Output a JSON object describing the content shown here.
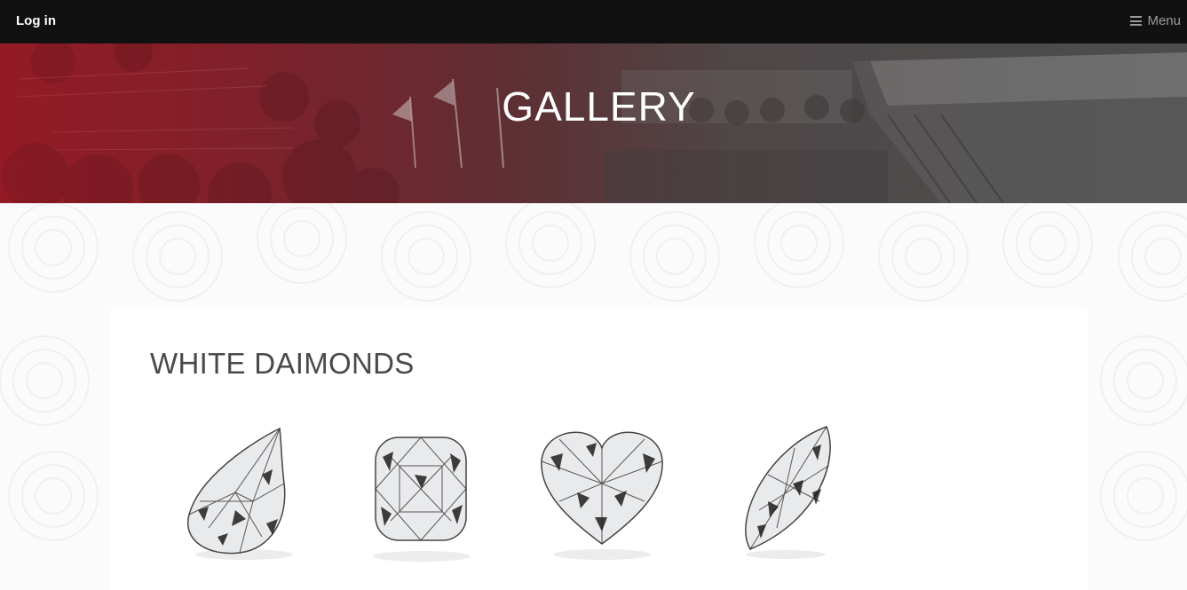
{
  "topbar": {
    "login_label": "Log in",
    "menu_label": "Menu",
    "menu_icon": "hamburger-icon"
  },
  "hero": {
    "title": "GALLERY"
  },
  "gallery": {
    "section_title": "WHITE DAIMONDS",
    "items": [
      {
        "shape": "pear"
      },
      {
        "shape": "cushion"
      },
      {
        "shape": "heart"
      },
      {
        "shape": "marquise"
      }
    ]
  },
  "colors": {
    "topbar_bg": "#111111",
    "hero_red": "#8e1a24",
    "hero_gray": "#4c4c4c",
    "title_text": "#4a4a4a"
  }
}
